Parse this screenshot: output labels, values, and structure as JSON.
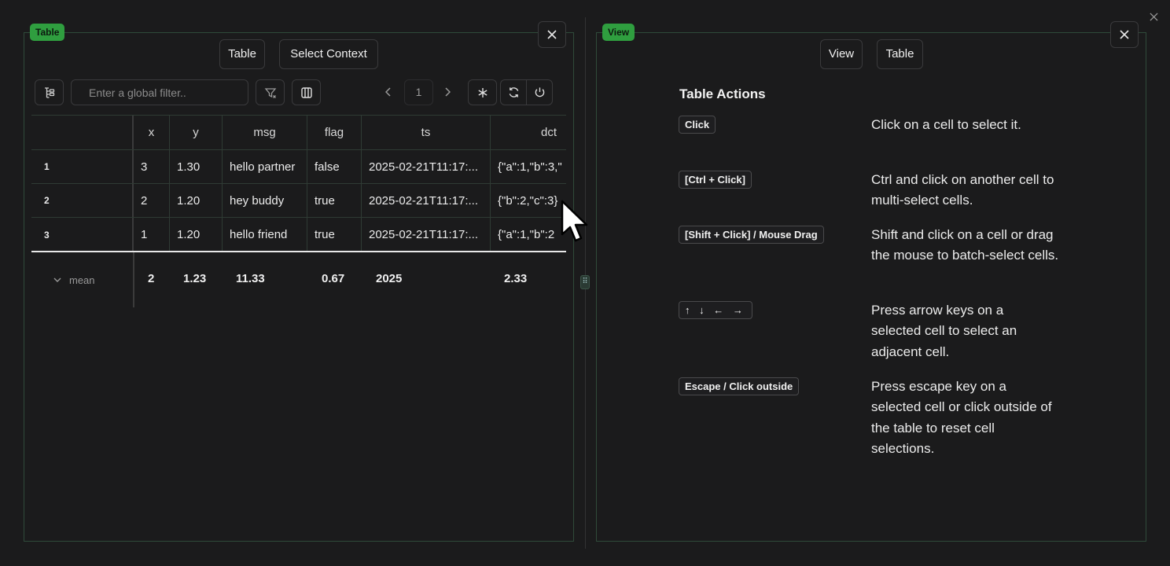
{
  "left_panel": {
    "badge": "Table",
    "buttons": {
      "table": "Table",
      "select_context": "Select Context"
    },
    "toolbar": {
      "global_filter_placeholder": "Enter a global filter..",
      "page": "1"
    },
    "table": {
      "columns": [
        "x",
        "y",
        "msg",
        "flag",
        "ts",
        "dct"
      ],
      "rows": [
        {
          "index": "1",
          "x": "3",
          "y": "1.30",
          "msg": "hello partner",
          "flag": "false",
          "ts": "2025-02-21T11:17:...",
          "dct": "{\"a\":1,\"b\":3,\""
        },
        {
          "index": "2",
          "x": "2",
          "y": "1.20",
          "msg": "hey buddy",
          "flag": "true",
          "ts": "2025-02-21T11:17:...",
          "dct": "{\"b\":2,\"c\":3}"
        },
        {
          "index": "3",
          "x": "1",
          "y": "1.20",
          "msg": "hello friend",
          "flag": "true",
          "ts": "2025-02-21T11:17:...",
          "dct": "{\"a\":1,\"b\":2"
        }
      ],
      "aggregate": {
        "label": "mean",
        "x": "2",
        "y": "1.23",
        "msg": "11.33",
        "flag": "0.67",
        "ts": "2025",
        "dct": "2.33"
      }
    }
  },
  "right_panel": {
    "badge": "View",
    "buttons": {
      "view": "View",
      "table": "Table"
    },
    "title": "Table Actions",
    "actions": [
      {
        "key": "Click",
        "description": "Click on a cell to select it."
      },
      {
        "key": "[Ctrl + Click]",
        "description": "Ctrl and click on another cell to multi-select cells."
      },
      {
        "key": "[Shift + Click] / Mouse Drag",
        "description": "Shift and click on a cell or drag the mouse to batch-select cells."
      },
      {
        "key": "↑ ↓ ← →",
        "description": "Press arrow keys on a selected cell to select an adjacent cell."
      },
      {
        "key": "Escape / Click outside",
        "description": "Press escape key on a selected cell or click outside of the table to reset cell selections."
      }
    ]
  }
}
